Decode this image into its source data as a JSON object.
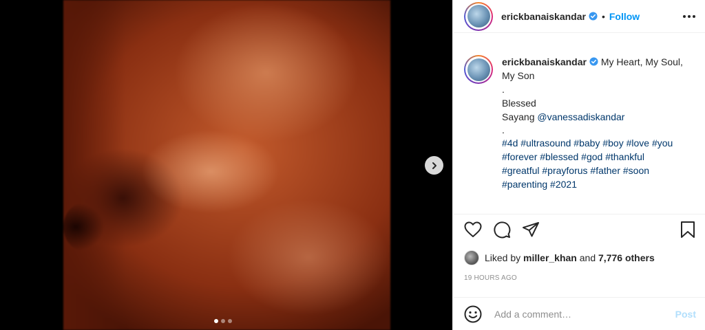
{
  "post": {
    "media": {
      "next_icon": "chevron-right-icon",
      "carousel_count": 3,
      "active_index": 1
    },
    "author": {
      "username": "erickbanaiskandar",
      "verified": true,
      "separator": "•",
      "follow_label": "Follow",
      "more_icon": "more-horizontal-icon"
    },
    "caption": {
      "username": "erickbanaiskandar",
      "lines": [
        "My Heart, My Soul,",
        "My Son",
        ".",
        "Blessed",
        "Sayang ",
        "."
      ],
      "mention": "@vanessadiskandar",
      "hashtags": [
        "#4d #ultrasound #baby #boy #love #you",
        "#forever #blessed #god #thankful",
        "#greatful #prayforus #father #soon",
        "#parenting #2021"
      ]
    },
    "actions": {
      "like_icon": "heart-icon",
      "comment_icon": "comment-icon",
      "share_icon": "share-icon",
      "save_icon": "bookmark-icon"
    },
    "likes": {
      "prefix": "Liked by",
      "liker": "miller_khan",
      "middle": "and",
      "others": "7,776 others"
    },
    "timestamp": "19 HOURS AGO",
    "comment": {
      "emoji_icon": "smiley-icon",
      "placeholder": "Add a comment…",
      "post_label": "Post"
    },
    "colors": {
      "accent": "#0095f6",
      "post_disabled": "#b2dffc",
      "link": "#00376b",
      "muted": "#8e8e8e"
    }
  }
}
